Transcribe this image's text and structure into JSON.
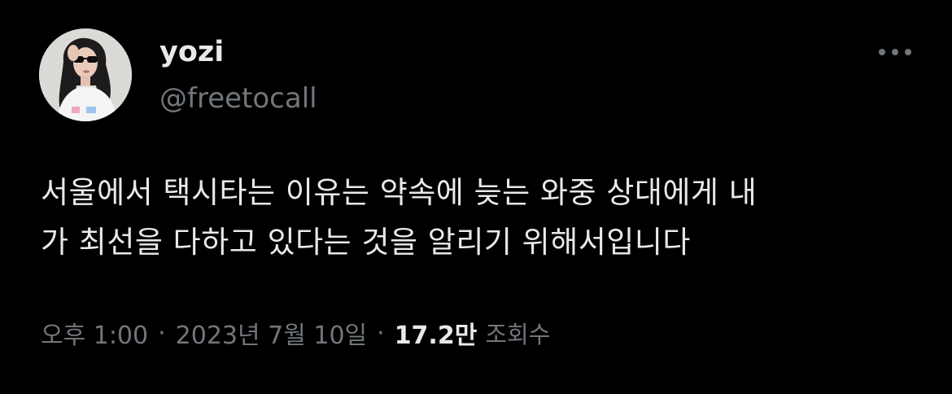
{
  "user": {
    "display_name": "yozi",
    "handle": "@freetocall"
  },
  "tweet": {
    "text": "서울에서 택시타는 이유는 약속에 늦는 와중 상대에게 내\n가 최선을 다하고 있다는 것을 알리기 위해서입니다",
    "time": "오후 1:00",
    "separator": "·",
    "date": "2023년 7월 10일",
    "views_count": "17.2만",
    "views_label": "조회수"
  },
  "icons": {
    "more": "more-horizontal-icon",
    "avatar": "profile-photo"
  },
  "colors": {
    "background": "#000000",
    "primary_text": "#e7e9ea",
    "secondary_text": "#71767b"
  }
}
